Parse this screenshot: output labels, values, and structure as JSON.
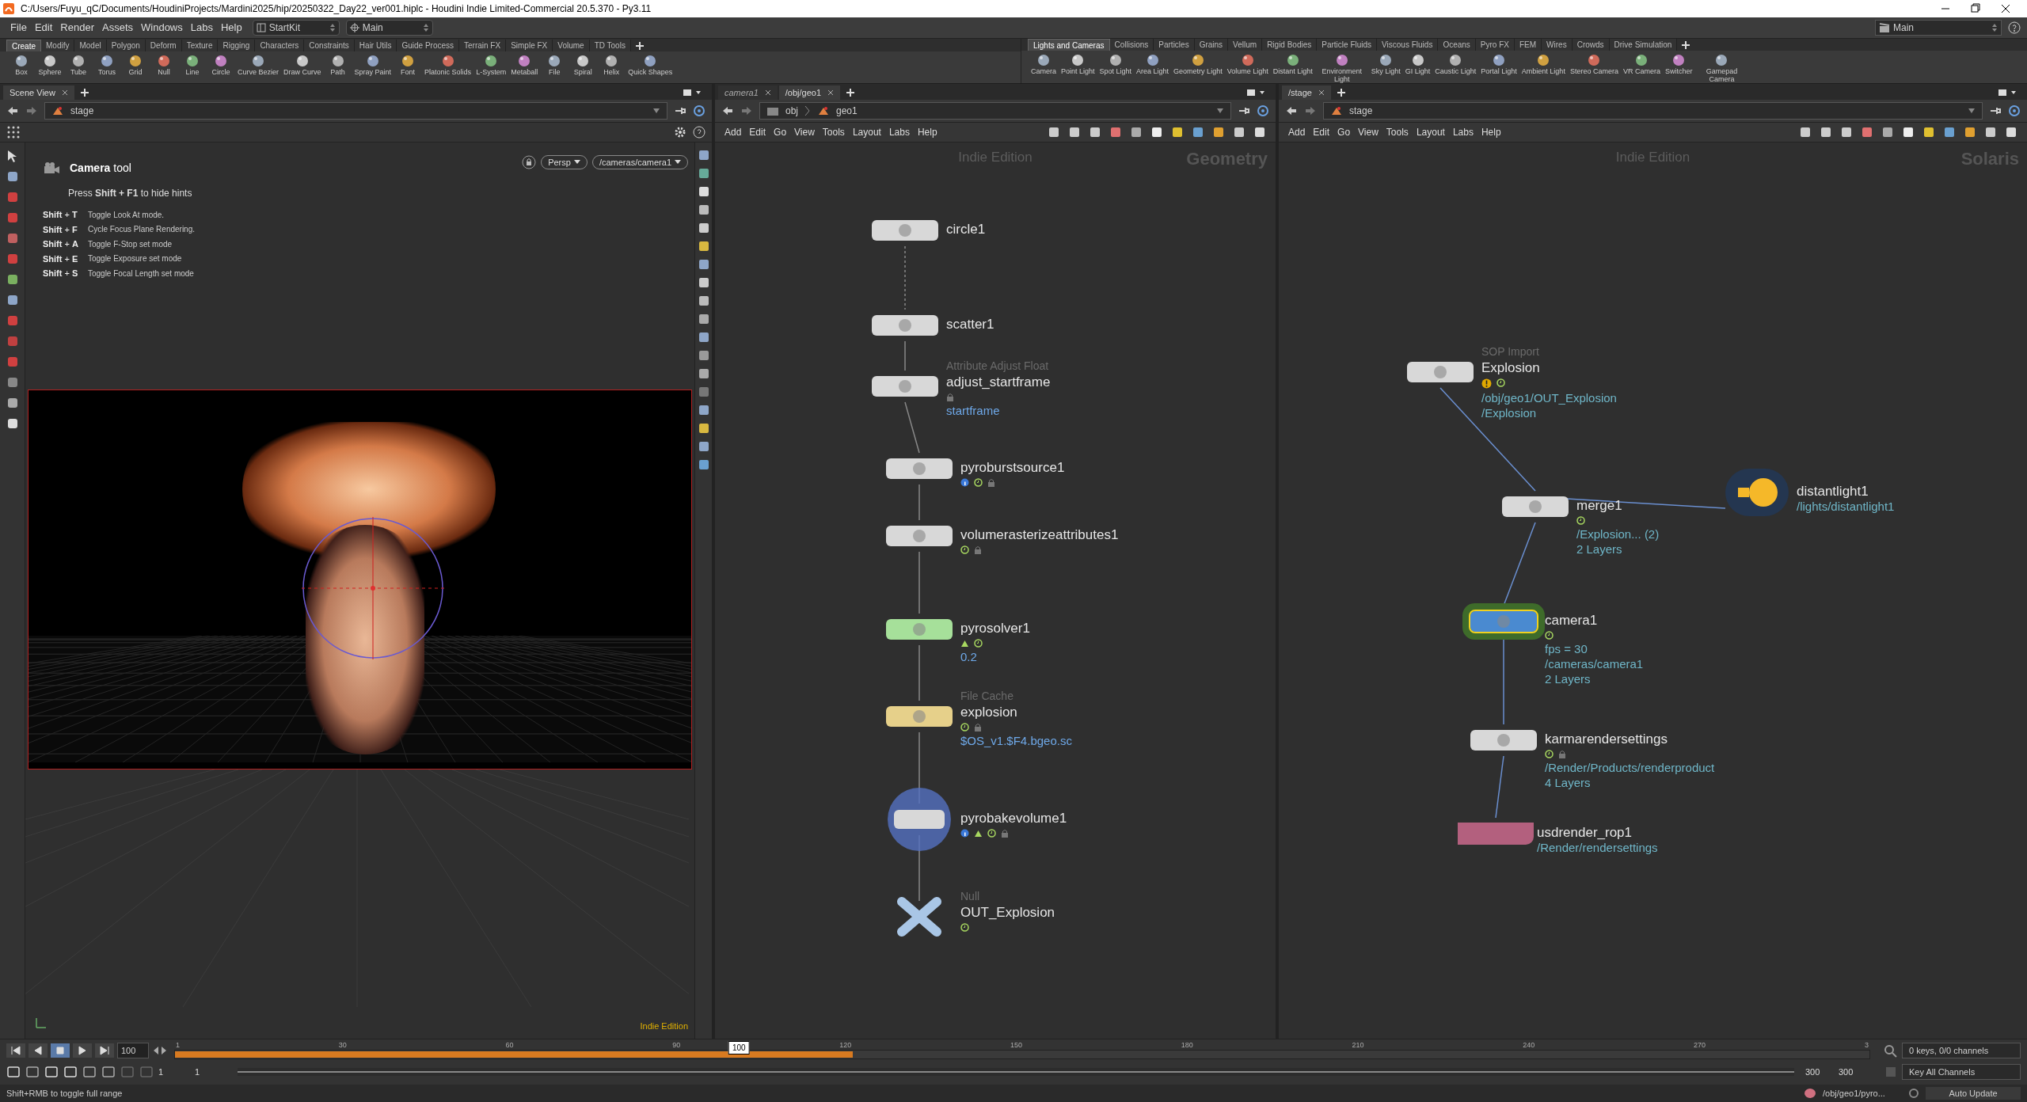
{
  "window": {
    "title": "C:/Users/Fuyu_qC/Documents/HoudiniProjects/Mardini2025/hip/20250322_Day22_ver001.hiplc - Houdini Indie Limited-Commercial 20.5.370 - Py3.11"
  },
  "menu": [
    "File",
    "Edit",
    "Render",
    "Assets",
    "Windows",
    "Labs",
    "Help"
  ],
  "desktop_selectors": [
    "StartKit",
    "Main"
  ],
  "right_desktop": "Main",
  "shelves": [
    {
      "tabs": [
        {
          "label": "Create",
          "selected": true
        },
        {
          "label": "Modify",
          "selected": false
        },
        {
          "label": "Model",
          "selected": false
        },
        {
          "label": "Polygon",
          "selected": false
        },
        {
          "label": "Deform",
          "selected": false
        },
        {
          "label": "Texture",
          "selected": false
        },
        {
          "label": "Rigging",
          "selected": false
        },
        {
          "label": "Characters",
          "selected": false
        },
        {
          "label": "Constraints",
          "selected": false
        },
        {
          "label": "Hair Utils",
          "selected": false
        },
        {
          "label": "Guide Process",
          "selected": false
        },
        {
          "label": "Terrain FX",
          "selected": false
        },
        {
          "label": "Simple FX",
          "selected": false
        },
        {
          "label": "Volume",
          "selected": false
        },
        {
          "label": "TD Tools",
          "selected": false
        }
      ],
      "tools": [
        "Box",
        "Sphere",
        "Tube",
        "Torus",
        "Grid",
        "Null",
        "Line",
        "Circle",
        "Curve Bezier",
        "Draw Curve",
        "Path",
        "Spray Paint",
        "Font",
        "Platonic Solids",
        "L-System",
        "Metaball",
        "File",
        "Spiral",
        "Helix",
        "Quick Shapes"
      ]
    },
    {
      "tabs": [
        {
          "label": "Lights and Cameras",
          "selected": true
        },
        {
          "label": "Collisions",
          "selected": false
        },
        {
          "label": "Particles",
          "selected": false
        },
        {
          "label": "Grains",
          "selected": false
        },
        {
          "label": "Vellum",
          "selected": false
        },
        {
          "label": "Rigid Bodies",
          "selected": false
        },
        {
          "label": "Particle Fluids",
          "selected": false
        },
        {
          "label": "Viscous Fluids",
          "selected": false
        },
        {
          "label": "Oceans",
          "selected": false
        },
        {
          "label": "Pyro FX",
          "selected": false
        },
        {
          "label": "FEM",
          "selected": false
        },
        {
          "label": "Wires",
          "selected": false
        },
        {
          "label": "Crowds",
          "selected": false
        },
        {
          "label": "Drive Simulation",
          "selected": false
        }
      ],
      "tools": [
        "Camera",
        "Point Light",
        "Spot Light",
        "Area Light",
        "Geometry Light",
        "Volume Light",
        "Distant Light",
        "Environment Light",
        "Sky Light",
        "GI Light",
        "Caustic Light",
        "Portal Light",
        "Ambient Light",
        "Stereo Camera",
        "VR Camera",
        "Switcher",
        "Gamepad Camera"
      ]
    }
  ],
  "scene_view": {
    "tab": "Scene View",
    "path": "stage",
    "hint_title": "**Camera** tool",
    "hint_line": "Press **Shift + F1** to hide hints",
    "view_menu": "Persp",
    "camera_menu": "/cameras/camera1",
    "shortcuts": [
      {
        "keys": "**Shift** + **T**",
        "text": "Toggle Look At mode."
      },
      {
        "keys": "**Shift** + **F**",
        "text": "Cycle Focus Plane Rendering."
      },
      {
        "keys": "**Shift** + **A**",
        "text": "Toggle F-Stop set mode"
      },
      {
        "keys": "**Shift** + **E**",
        "text": "Toggle Exposure set mode"
      },
      {
        "keys": "**Shift** + **S**",
        "text": "Toggle Focal Length set mode"
      }
    ],
    "edition": "Indie Edition"
  },
  "networks": [
    {
      "tabs": [
        {
          "label": "camera1",
          "selected": false
        },
        {
          "label": "/obj/geo1",
          "selected": true
        }
      ],
      "path": [
        "obj",
        "geo1"
      ],
      "menu": [
        "Add",
        "Edit",
        "Go",
        "View",
        "Tools",
        "Layout",
        "Labs",
        "Help"
      ],
      "edition": "Indie Edition",
      "context": "Geometry",
      "nodes": [
        {
          "name": "circle1",
          "kind": "standard",
          "color": "#d8d8d8"
        },
        {
          "name": "scatter1",
          "kind": "standard",
          "color": "#d8d8d8"
        },
        {
          "type": "Attribute Adjust Float",
          "name": "adjust_startframe",
          "kind": "standard",
          "color": "#d8d8d8",
          "flags": [
            {
              "kind": "lock"
            }
          ],
          "details": [
            "startframe"
          ]
        },
        {
          "name": "pyroburstsource1",
          "kind": "standard",
          "color": "#d8d8d8",
          "flags": [
            {
              "kind": "info"
            },
            {
              "kind": "clock"
            },
            {
              "kind": "lock"
            }
          ]
        },
        {
          "name": "volumerasterizeattributes1",
          "kind": "standard",
          "color": "#d8d8d8",
          "flags": [
            {
              "kind": "clock"
            },
            {
              "kind": "lock"
            }
          ]
        },
        {
          "name": "pyrosolver1",
          "kind": "standard",
          "color": "#a6e09a",
          "flags": [
            {
              "kind": "time"
            },
            {
              "kind": "clock"
            }
          ],
          "details": [
            "0.2"
          ]
        },
        {
          "type": "File Cache",
          "name": "explosion",
          "kind": "standard",
          "color": "#e6d08a",
          "flags": [
            {
              "kind": "clock"
            },
            {
              "kind": "lock"
            }
          ],
          "details": [
            "$OS_v1.$F4.bgeo.sc"
          ]
        },
        {
          "name": "pyrobakevolume1",
          "kind": "bake",
          "color": "#d8d8d8",
          "flags": [
            {
              "kind": "info"
            },
            {
              "kind": "time"
            },
            {
              "kind": "clock"
            },
            {
              "kind": "lock"
            }
          ]
        },
        {
          "type": "Null",
          "name": "OUT_Explosion",
          "kind": "null",
          "color": "#a9c6e6",
          "flags": [
            {
              "kind": "clock"
            }
          ]
        }
      ]
    },
    {
      "tabs": [
        {
          "label": "/stage",
          "selected": true
        }
      ],
      "path": [
        "stage"
      ],
      "menu": [
        "Add",
        "Edit",
        "Go",
        "View",
        "Tools",
        "Layout",
        "Labs",
        "Help"
      ],
      "edition": "Indie Edition",
      "context": "Solaris",
      "nodes": [
        {
          "type": "SOP Import",
          "name": "Explosion",
          "kind": "standard",
          "color": "#d8d8d8",
          "selected": false,
          "flags": [
            {
              "kind": "warning"
            },
            {
              "kind": "clock"
            }
          ],
          "details": [
            "/obj/geo1/OUT_Explosion",
            "/Explosion"
          ]
        },
        {
          "name": "merge1",
          "kind": "standard",
          "color": "#d8d8d8",
          "selected": false,
          "flags": [
            {
              "kind": "clock"
            }
          ],
          "details": [
            "/Explosion... (2)",
            "2 Layers"
          ]
        },
        {
          "name": "distantlight1",
          "kind": "light",
          "color": "#f5b829",
          "selected": false,
          "details": [
            "/lights/distantlight1"
          ]
        },
        {
          "name": "camera1",
          "kind": "standard",
          "color": "#4a8ad0",
          "selected": true,
          "flags": [
            {
              "kind": "clock"
            }
          ],
          "details": [
            "fps = 30",
            "/cameras/camera1",
            "2 Layers"
          ]
        },
        {
          "name": "karmarendersettings",
          "kind": "standard",
          "color": "#d8d8d8",
          "selected": false,
          "flags": [
            {
              "kind": "clock"
            },
            {
              "kind": "lock"
            }
          ],
          "details": [
            "/Render/Products/renderproduct",
            "4 Layers"
          ]
        },
        {
          "name": "usdrender_rop1",
          "kind": "rop",
          "color": "#b3607e",
          "selected": false,
          "details": [
            "/Render/rendersettings"
          ]
        }
      ]
    }
  ],
  "timeline": {
    "frame": "100",
    "ticks": [
      "1",
      "30",
      "60",
      "90",
      "120",
      "150",
      "180",
      "210",
      "240",
      "270",
      "3"
    ],
    "current": "100",
    "cache": {
      "level": 0.4
    },
    "playhead": {
      "level": 0.333
    },
    "range": {
      "level": 1
    },
    "start": "1",
    "start_2": "1",
    "end": "300",
    "end_2": "300",
    "keys": "0 keys, 0/0 channels",
    "key_button": "Key All Channels"
  },
  "status_bar": {
    "message": "Shift+RMB to toggle full range",
    "path": "/obj/geo1/pyro...",
    "update": "Auto Update"
  }
}
